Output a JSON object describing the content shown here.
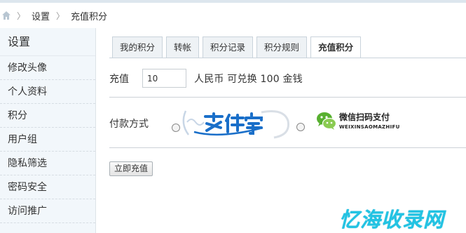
{
  "breadcrumb": {
    "items": [
      "设置",
      "充值积分"
    ]
  },
  "sidebar": {
    "title": "设置",
    "items": [
      {
        "label": "修改头像"
      },
      {
        "label": "个人资料"
      },
      {
        "label": "积分"
      },
      {
        "label": "用户组"
      },
      {
        "label": "隐私筛选"
      },
      {
        "label": "密码安全"
      },
      {
        "label": "访问推广"
      }
    ]
  },
  "tabs": [
    {
      "label": "我的积分",
      "active": false
    },
    {
      "label": "转帐",
      "active": false
    },
    {
      "label": "积分记录",
      "active": false
    },
    {
      "label": "积分规则",
      "active": false
    },
    {
      "label": "充值积分",
      "active": true
    }
  ],
  "recharge": {
    "label": "充值",
    "input_value": "10",
    "suffix": "人民币 可兑换  100 金钱"
  },
  "payment": {
    "label": "付款方式",
    "options": [
      {
        "name": "支付宝",
        "selected": true
      },
      {
        "name": "微信扫码支付",
        "subtitle": "WEIXINSAOMAZHIFU",
        "selected": false
      }
    ]
  },
  "submit": {
    "label": "立即充值"
  },
  "watermark": {
    "text": "忆海收录网"
  },
  "colors": {
    "sidebar_bg": "#f2f7fb",
    "alipay_blue": "#1a6fc9",
    "wechat_green": "#58b030",
    "watermark": "#22c3e3"
  }
}
